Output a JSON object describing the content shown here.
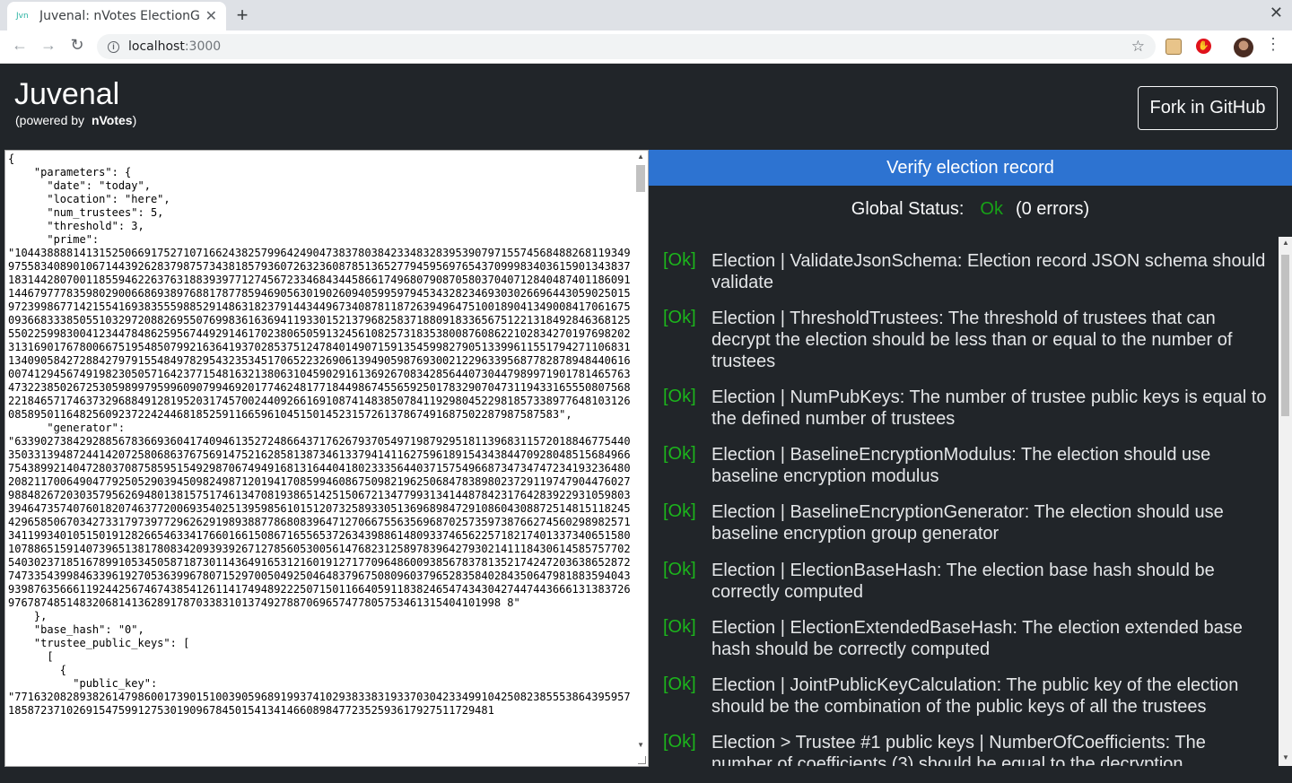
{
  "browser": {
    "tab_title": "Juvenal: nVotes ElectionG",
    "tab_favicon": "Jvn",
    "url_host": "localhost",
    "url_port": ":3000"
  },
  "header": {
    "title": "Juvenal",
    "powered_prefix": "(powered by",
    "powered_brand": "nVotes",
    "powered_suffix": ")",
    "fork_button": "Fork in GitHub"
  },
  "editor": {
    "content": "{\n    \"parameters\": {\n      \"date\": \"today\",\n      \"location\": \"here\",\n      \"num_trustees\": 5,\n      \"threshold\": 3,\n      \"prime\":\n\"104438888141315250669175271071662438257996424904738378038423348328395390797155745684882681193499755834089010671443926283798757343818579360726323608785136527794595697654370999834036159013438371831442807001185594622637631883939771274567233468434458661749680790870580370407128404874011860911446797778359802900668693897688178778594690563019026094059959794534328234693030266964430590250159723998677142155416938355598852914863182379144344967340878118726394964751001890413490084170616750936683338505510329720882695507699836163694119330152137968258371880918336567512213184928463681255502259983004123447848625956744929146170238065059132456108257318353800876086221028342701976982023131690176780066751954850799216364193702853751247840149071591354599827905133996115517942711068311340905842728842797915548497829543235345170652232690613949059876930021229633956877828789484406160074129456749198230505716423771548163213806310459029161369267083428564407304479899719017814657634732238502672530598997959960907994692017746248177184498674556592501783290704731194331655508075682218465717463732968849128195203174570024409266169108741483850784119298045229818573389776481031260858950116482560923722424468185259116659610451501452315726137867491687502287987587583\",\n      \"generator\":\n\"633902738429288567836693604174094613527248664371762679370549719879295181139683115720188467754403503313948724414207258068637675691475216285813873461337941411627596189154343844709280485156849667543899214047280370875859515492987067494916813164404180233356440371575496687347347472341932364802082117006490477925052903945098249871201941708599460867509821962506847838980237291197479044760279884826720303579562694801381575174613470819386514251506721347799313414487842317642839229310598033946473574076018207463772006935402513959856101512073258933051369689847291086043088725148151182454296585067034273317973977296262919893887786808396471270667556356968702573597387662745602989825713411993401051501912826654633417660166150867165565372634398861480933746562257182174013373406515801078865159140739651381780834209393926712785605300561476823125897839642793021411184306145857577025403023718516789910534505871873011436491653121601912717709648600938567837813521742472036386528727473354399846339619270536399678071529700504925046483796750809603796528358402843506479818835940439398763566611924425674674385412611417494892225071501166405911838246547434304274474436661313837269767874851483206814136289178703383101374927887069657477805753461315404101998 8\"\n    },\n    \"base_hash\": \"0\",\n    \"trustee_public_keys\": [\n      [\n        {\n          \"public_key\":\n\"77163208289382614798600173901510039059689199374102938338319337030423349910425082385553864395957185872371026915475991275301909678450154134146608984772352593617927511729481"
  },
  "verify_button": "Verify election record",
  "global_status": {
    "label": "Global Status:",
    "value": "Ok",
    "errors": "(0 errors)"
  },
  "results": [
    {
      "badge": "[Ok]",
      "text": "Election | ValidateJsonSchema: Election record JSON schema should validate"
    },
    {
      "badge": "[Ok]",
      "text": "Election | ThresholdTrustees: The threshold of trustees that can decrypt the election should be less than or equal to the number of trustees"
    },
    {
      "badge": "[Ok]",
      "text": "Election | NumPubKeys: The number of trustee public keys is equal to the defined number of trustees"
    },
    {
      "badge": "[Ok]",
      "text": "Election | BaselineEncryptionModulus: The election should use baseline encryption modulus"
    },
    {
      "badge": "[Ok]",
      "text": "Election | BaselineEncryptionGenerator: The election should use baseline encryption group generator"
    },
    {
      "badge": "[Ok]",
      "text": "Election | ElectionBaseHash: The election base hash should be correctly computed"
    },
    {
      "badge": "[Ok]",
      "text": "Election | ElectionExtendedBaseHash: The election extended base hash should be correctly computed"
    },
    {
      "badge": "[Ok]",
      "text": "Election | JointPublicKeyCalculation: The public key of the election should be the combination of the public keys of all the trustees"
    },
    {
      "badge": "[Ok]",
      "text": "Election > Trustee #1 public keys | NumberOfCoefficients: The number of coefficients (3) should be equal to the decryption"
    }
  ]
}
